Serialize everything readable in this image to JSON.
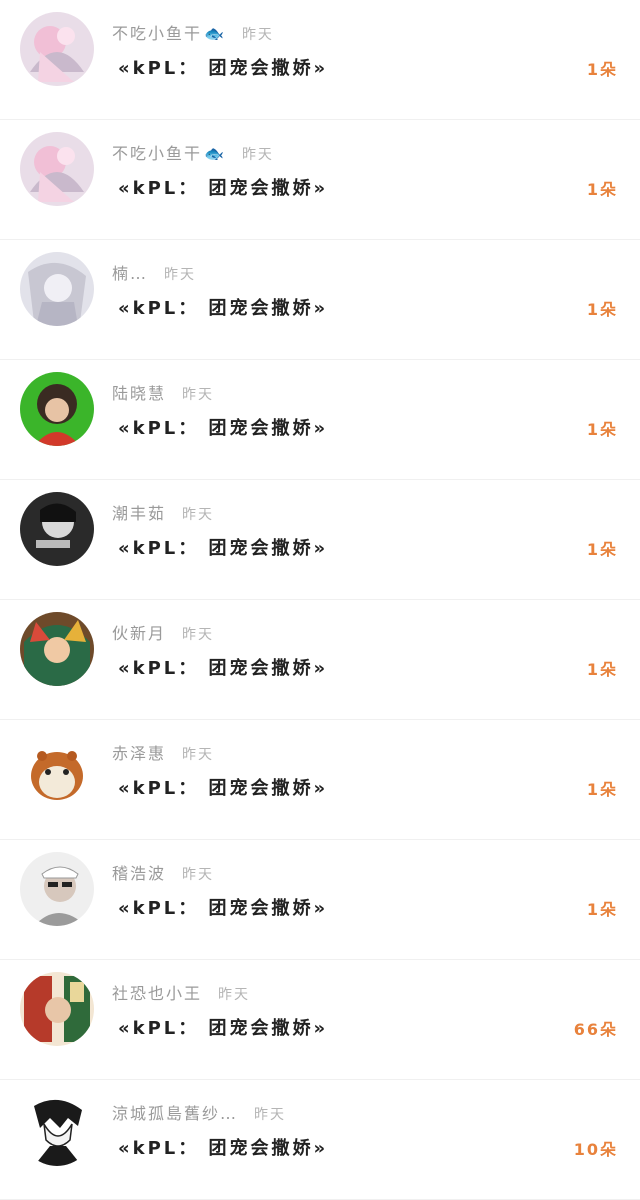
{
  "accent_color": "#e8823c",
  "items": [
    {
      "name": "不吃小鱼干",
      "emoji": "🐟",
      "time": "昨天",
      "message": "«kPL： 团宠会撒娇»",
      "count": "1朵",
      "avatar": "pink-anime-avatar"
    },
    {
      "name": "不吃小鱼干",
      "emoji": "🐟",
      "time": "昨天",
      "message": "«kPL： 团宠会撒娇»",
      "count": "1朵",
      "avatar": "pink-anime-avatar"
    },
    {
      "name": "楠…",
      "emoji": "",
      "time": "昨天",
      "message": "«kPL： 团宠会撒娇»",
      "count": "1朵",
      "avatar": "silver-anime-avatar"
    },
    {
      "name": "陆晓慧",
      "emoji": "",
      "time": "昨天",
      "message": "«kPL： 团宠会撒娇»",
      "count": "1朵",
      "avatar": "green-anime-avatar"
    },
    {
      "name": "潮丰茹",
      "emoji": "",
      "time": "昨天",
      "message": "«kPL： 团宠会撒娇»",
      "count": "1朵",
      "avatar": "black-white-photo-avatar"
    },
    {
      "name": "伙新月",
      "emoji": "",
      "time": "昨天",
      "message": "«kPL： 团宠会撒娇»",
      "count": "1朵",
      "avatar": "colorful-anime-avatar"
    },
    {
      "name": "赤泽惠",
      "emoji": "",
      "time": "昨天",
      "message": "«kPL： 团宠会撒娇»",
      "count": "1朵",
      "avatar": "hamster-avatar"
    },
    {
      "name": "稽浩波",
      "emoji": "",
      "time": "昨天",
      "message": "«kPL： 团宠会撒娇»",
      "count": "1朵",
      "avatar": "sunglasses-person-avatar"
    },
    {
      "name": "社恐也小王",
      "emoji": "",
      "time": "昨天",
      "message": "«kPL： 团宠会撒娇»",
      "count": "66朵",
      "avatar": "poster-person-avatar"
    },
    {
      "name": "涼城孤島舊纱…",
      "emoji": "",
      "time": "昨天",
      "message": "«kPL： 团宠会撒娇»",
      "count": "10朵",
      "avatar": "sketch-anime-avatar"
    }
  ]
}
